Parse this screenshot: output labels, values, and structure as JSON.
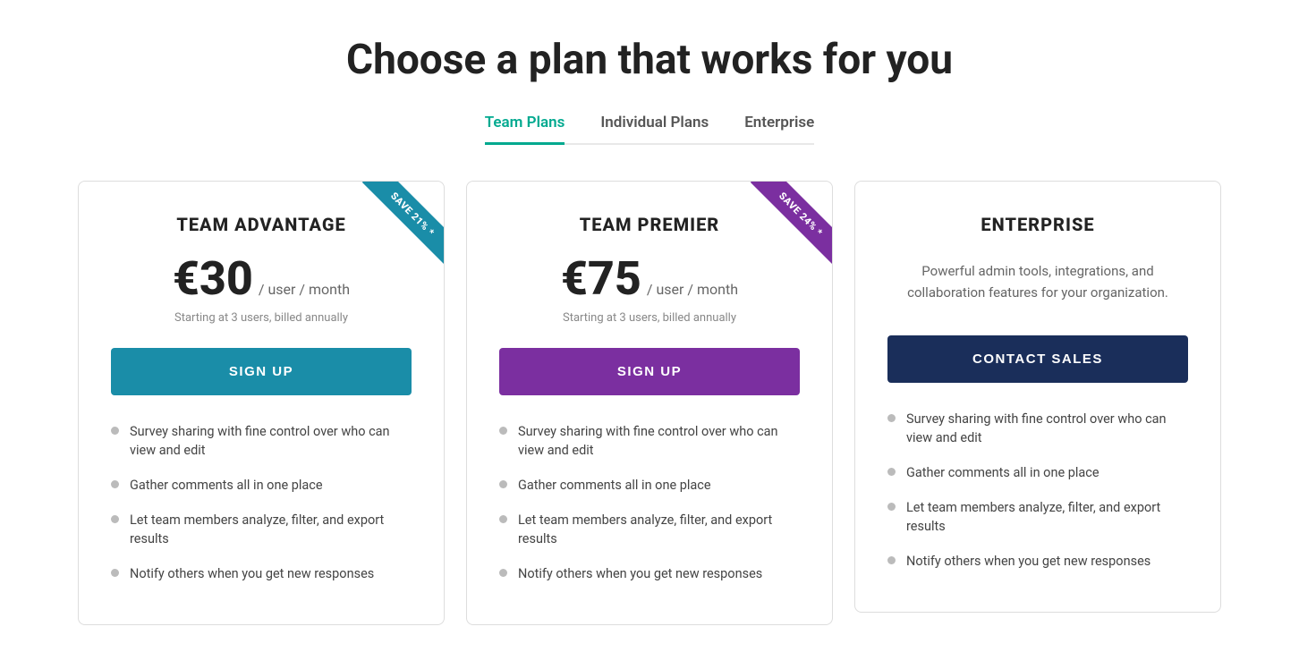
{
  "page": {
    "title": "Choose a plan that works for you"
  },
  "tabs": [
    {
      "id": "team-plans",
      "label": "Team Plans",
      "active": true
    },
    {
      "id": "individual-plans",
      "label": "Individual Plans",
      "active": false
    },
    {
      "id": "enterprise",
      "label": "Enterprise",
      "active": false
    }
  ],
  "plans": [
    {
      "id": "team-advantage",
      "name": "TEAM ADVANTAGE",
      "price": "€30",
      "price_unit": "/ user / month",
      "billing_note": "Starting at 3 users, billed annually",
      "cta_label": "SIGN UP",
      "cta_style": "teal",
      "ribbon": true,
      "ribbon_style": "teal",
      "ribbon_text": "SAVE 21% *",
      "features": [
        "Survey sharing with fine control over who can view and edit",
        "Gather comments all in one place",
        "Let team members analyze, filter, and export results",
        "Notify others when you get new responses"
      ]
    },
    {
      "id": "team-premier",
      "name": "TEAM PREMIER",
      "price": "€75",
      "price_unit": "/ user / month",
      "billing_note": "Starting at 3 users, billed annually",
      "cta_label": "SIGN UP",
      "cta_style": "purple",
      "ribbon": true,
      "ribbon_style": "purple",
      "ribbon_text": "SAVE 24% *",
      "features": [
        "Survey sharing with fine control over who can view and edit",
        "Gather comments all in one place",
        "Let team members analyze, filter, and export results",
        "Notify others when you get new responses"
      ]
    },
    {
      "id": "enterprise",
      "name": "ENTERPRISE",
      "price": null,
      "price_unit": null,
      "billing_note": null,
      "enterprise_desc": "Powerful admin tools, integrations, and collaboration features for your organization.",
      "cta_label": "CONTACT SALES",
      "cta_style": "navy",
      "ribbon": false,
      "features": [
        "Survey sharing with fine control over who can view and edit",
        "Gather comments all in one place",
        "Let team members analyze, filter, and export results",
        "Notify others when you get new responses"
      ]
    }
  ]
}
